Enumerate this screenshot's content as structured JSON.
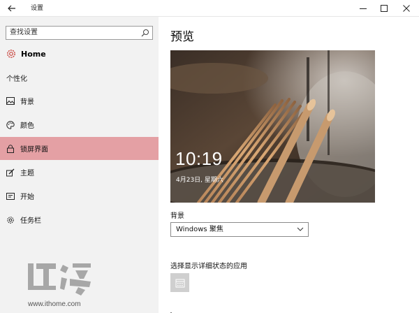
{
  "window": {
    "title": "设置",
    "back_icon": "back-arrow-icon",
    "controls": [
      "minimize-icon",
      "maximize-icon",
      "close-icon"
    ]
  },
  "sidebar": {
    "search": {
      "placeholder": "查找设置",
      "icon": "search-icon"
    },
    "home": {
      "label": "Home",
      "icon": "gear-icon"
    },
    "section_title": "个性化",
    "items": [
      {
        "label": "背景",
        "icon": "picture-icon",
        "active": false
      },
      {
        "label": "颜色",
        "icon": "palette-icon",
        "active": false
      },
      {
        "label": "锁屏界面",
        "icon": "lock-icon",
        "active": true
      },
      {
        "label": "主题",
        "icon": "theme-brush-icon",
        "active": false
      },
      {
        "label": "开始",
        "icon": "start-menu-icon",
        "active": false
      },
      {
        "label": "任务栏",
        "icon": "taskbar-icon",
        "active": false
      }
    ],
    "watermark": {
      "brand": "IT之家",
      "url": "www.ithome.com"
    }
  },
  "main": {
    "title": "预览",
    "preview": {
      "time": "10:19",
      "date": "4月23日, 星期六"
    },
    "background": {
      "label": "背景",
      "value": "Windows 聚焦"
    },
    "apps": {
      "label": "选择显示详细状态的应用",
      "tile_icon": "calendar-icon"
    }
  },
  "colors": {
    "active_item": "#e4a0a4",
    "sidebar_bg": "#f2f2f2",
    "app_tile": "#cfcfcf"
  }
}
